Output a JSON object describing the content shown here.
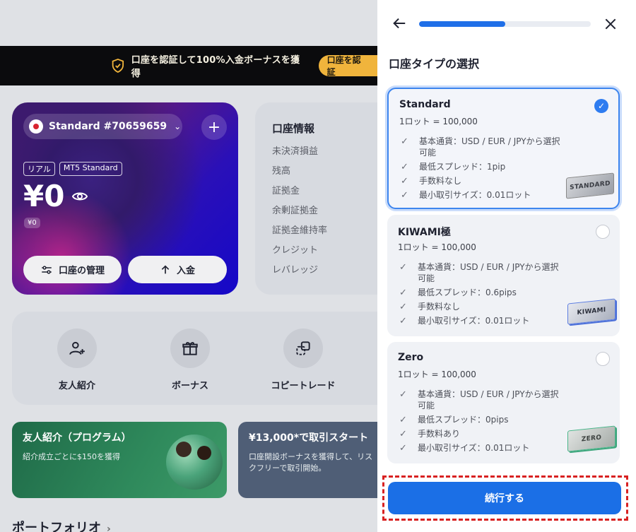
{
  "promo": {
    "text": "口座を認証して100%入金ボーナスを獲得",
    "verify_label": "口座を認証"
  },
  "account_card": {
    "account_name": "Standard #70659659",
    "tags": [
      "リアル",
      "MT5 Standard"
    ],
    "balance": "¥0",
    "mini_balance": "¥0",
    "manage_label": "口座の管理",
    "deposit_label": "入金"
  },
  "account_info": {
    "title": "口座情報",
    "items": [
      "未決済損益",
      "残高",
      "証拠金",
      "余剰証拠金",
      "証拠金維持率",
      "クレジット",
      "レバレッジ"
    ]
  },
  "quick_actions": [
    {
      "label": "友人紹介",
      "icon": "add-friend-icon"
    },
    {
      "label": "ボーナス",
      "icon": "gift-icon"
    },
    {
      "label": "コピートレード",
      "icon": "copy-trade-icon"
    }
  ],
  "banners": {
    "referral": {
      "title": "友人紹介（プログラム）",
      "subtitle": "紹介成立ごとに$150を獲得"
    },
    "start": {
      "title": "¥13,000*で取引スタート",
      "subtitle": "口座開設ボーナスを獲得して、リス\nクフリーで取引開始。"
    }
  },
  "portfolio": {
    "label": "ポートフォリオ"
  },
  "panel": {
    "title": "口座タイプの選択",
    "progress": 0.5,
    "account_types": [
      {
        "name": "Standard",
        "lot": "1ロット = 100,000",
        "features": [
          "基本通貨：USD / EUR / JPYから選択可能",
          "最低スプレッド：1pip",
          "手数料なし",
          "最小取引サイズ：0.01ロット"
        ],
        "badge": "STANDARD",
        "selected": true
      },
      {
        "name": "KIWAMI極",
        "lot": "1ロット = 100,000",
        "features": [
          "基本通貨：USD / EUR / JPYから選択可能",
          "最低スプレッド：0.6pips",
          "手数料なし",
          "最小取引サイズ：0.01ロット"
        ],
        "badge": "KIWAMI",
        "selected": false
      },
      {
        "name": "Zero",
        "lot": "1ロット = 100,000",
        "features": [
          "基本通貨：USD / EUR / JPYから選択可能",
          "最低スプレッド：0pips",
          "手数料あり",
          "最小取引サイズ：0.01ロット"
        ],
        "badge": "ZERO",
        "selected": false
      }
    ],
    "continue_label": "続行する"
  },
  "colors": {
    "accent": "#1b6fe6",
    "highlight_border": "#d82121",
    "promo_button": "#f0b43c"
  }
}
